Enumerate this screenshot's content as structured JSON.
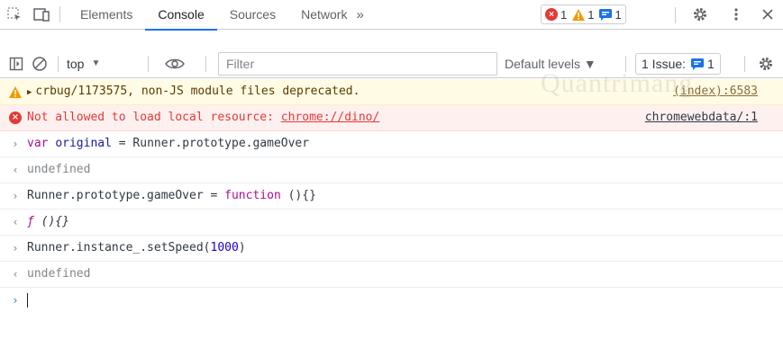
{
  "devtools": {
    "tabs": [
      "Elements",
      "Console",
      "Sources",
      "Network"
    ],
    "more_tabs": "»",
    "error_count": "1",
    "warning_count": "1",
    "info_count": "1"
  },
  "toolbar": {
    "context": "top",
    "filter_placeholder": "Filter",
    "levels": "Default levels ▼",
    "issues": "1 Issue:",
    "issues_count": "1"
  },
  "messages": {
    "warning": {
      "text": "crbug/1173575, non-JS module files deprecated.",
      "source": "(index):6583"
    },
    "error": {
      "prefix": "Not allowed to load local resource: ",
      "url": "chrome://dino/",
      "source": "chromewebdata/:1"
    },
    "entries": [
      {
        "var_kw": "var",
        "name": "original",
        "rest": " = Runner.prototype.gameOver"
      },
      {
        "result": "undefined"
      },
      {
        "prefix": "Runner.prototype.gameOver = ",
        "fn_kw": "function",
        "suffix": " (){}"
      },
      {
        "fsym": "ƒ",
        "fbody": " (){}"
      },
      {
        "prefix": "Runner.instance_.setSpeed(",
        "num": "1000",
        "suffix": ")"
      },
      {
        "result": "undefined"
      }
    ]
  },
  "watermark": "Quantrimang",
  "colors": {
    "accent": "#1a73e8",
    "error": "#e53935",
    "warning": "#f29900"
  }
}
